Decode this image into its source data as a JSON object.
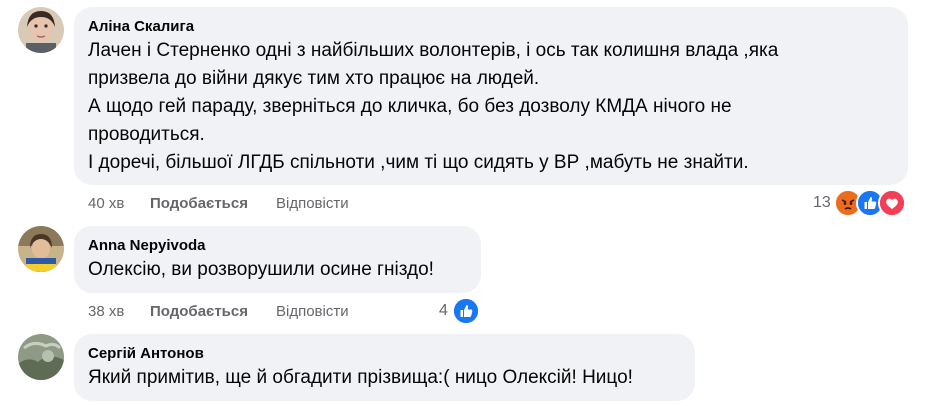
{
  "comments": [
    {
      "author": "Аліна Скалига",
      "lines": [
        "Лачен і Стерненко одні з найбільших волонтерів, і ось так колишня влада ,яка",
        "призвела до війни дякує тим хто працює на людей.",
        "А щодо гей параду, зверніться до кличка, бо без дозволу КМДА нічого не",
        "проводиться.",
        "І доречі, більшої ЛГДБ спільноти ,чим ті що сидять у ВР ,мабуть не знайти."
      ],
      "time": "40 хв",
      "like_label": "Подобається",
      "reply_label": "Відповісти",
      "reaction_count": "13",
      "reactions": [
        "angry",
        "like",
        "love"
      ]
    },
    {
      "author": "Anna Nepyivoda",
      "lines": [
        "Олексію, ви розворушили осине гніздо!"
      ],
      "time": "38 хв",
      "like_label": "Подобається",
      "reply_label": "Відповісти",
      "reaction_count": "4",
      "reactions": [
        "like"
      ]
    },
    {
      "author": "Сергій Антонов",
      "lines": [
        "Який примітив, ще й обгадити прізвища:( ницо Олексій! Ницо!"
      ]
    }
  ],
  "colors": {
    "bubble": "#f0f2f5",
    "text": "#050505",
    "meta": "#65676b",
    "like_blue": "#1877f2",
    "love_red": "#f33e58",
    "angry_orange": "#e9710f"
  }
}
